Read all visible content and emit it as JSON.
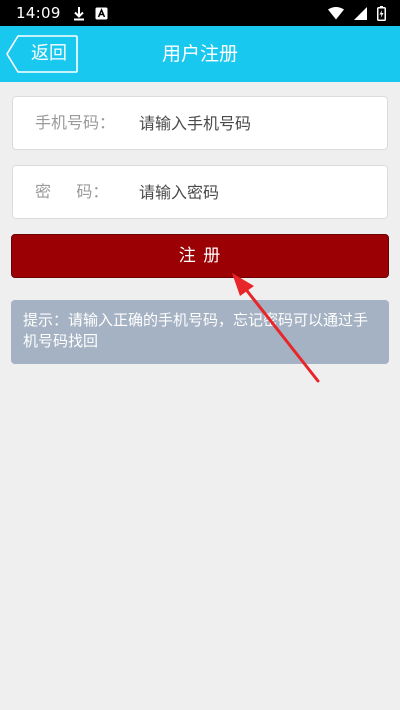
{
  "status_bar": {
    "time": "14:09",
    "left_icons": [
      "download-icon",
      "app-notification-icon"
    ],
    "right_icons": [
      "wifi-icon",
      "signal-icon",
      "battery-icon"
    ]
  },
  "header": {
    "back_label": "返回",
    "title": "用户注册",
    "background_color": "#18c8ee"
  },
  "form": {
    "phone": {
      "label": "手机号码：",
      "placeholder": "请输入手机号码",
      "value": ""
    },
    "password": {
      "label": "密     码：",
      "placeholder": "请输入密码",
      "value": ""
    },
    "register_label": "注  册",
    "register_color": "#9b0004"
  },
  "hint": {
    "text": "提示：请输入正确的手机号码，忘记密码可以通过手机号码找回"
  },
  "annotation": {
    "icon": "red-arrow-icon",
    "color": "#e8262a"
  }
}
